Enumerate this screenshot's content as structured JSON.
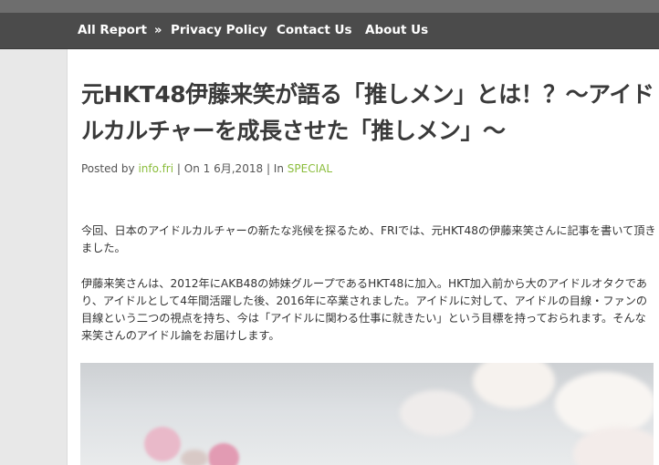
{
  "nav": {
    "items": [
      {
        "label": "All Report",
        "chevron": "»"
      },
      {
        "label": "Privacy Policy"
      },
      {
        "label": "Contact Us"
      },
      {
        "label": "About Us"
      }
    ]
  },
  "post": {
    "title": "元HKT48伊藤来笑が語る「推しメン」とは！？～アイドルカルチャーを成長させた「推しメン」～",
    "meta": {
      "posted_by_label": "Posted by",
      "author": "info.fri",
      "on_label": "| On",
      "date": "1 6月,2018",
      "in_label": "| In",
      "category": "SPECIAL"
    },
    "paragraphs": [
      "今回、日本のアイドルカルチャーの新たな兆候を探るため、FRIでは、元HKT48の伊藤来笑さんに記事を書いて頂きました。",
      "伊藤来笑さんは、2012年にAKB48の姉妹グループであるHKT48に加入。HKT加入前から大のアイドルオタクであり、アイドルとして4年間活躍した後、2016年に卒業されました。アイドルに対して、アイドルの目線・ファンの目線という二つの視点を持ち、今は「アイドルに関わる仕事に就きたい」という目標を持っておられます。そんな来笑さんのアイドル論をお届けします。"
    ]
  },
  "colors": {
    "nav_bg": "#4b4b4b",
    "link_green": "#8bbd3c",
    "title": "#3a3a3a"
  }
}
